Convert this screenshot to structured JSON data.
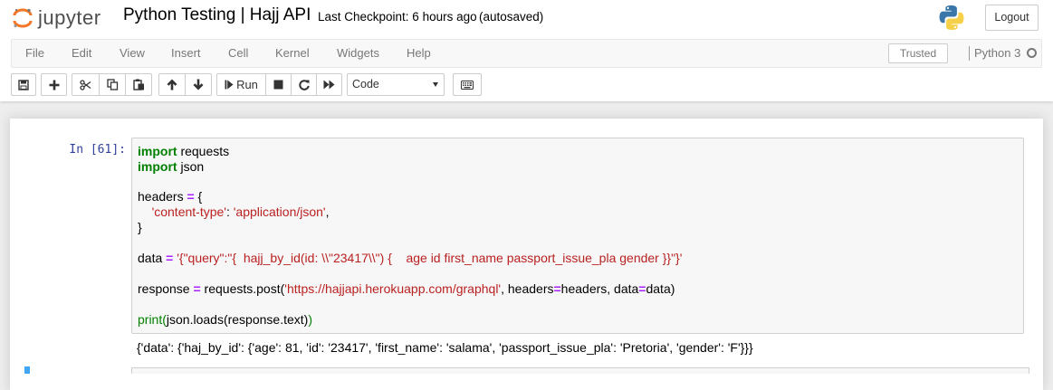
{
  "header": {
    "logo_text": "jupyter",
    "notebook_name": "Python Testing | Hajj API",
    "checkpoint": "Last Checkpoint: 6 hours ago",
    "autosave_status": "(autosaved)",
    "kernel_logo_icon": "python-logo-icon",
    "logout_label": "Logout"
  },
  "menubar": {
    "items": [
      "File",
      "Edit",
      "View",
      "Insert",
      "Cell",
      "Kernel",
      "Widgets",
      "Help"
    ],
    "trusted_label": "Trusted",
    "kernel_name": "Python 3",
    "kernel_indicator_icon": "kernel-idle-circle-icon"
  },
  "toolbar": {
    "icons": [
      "save-icon",
      "plus-icon",
      "cut-icon",
      "copy-icon",
      "paste-icon",
      "arrow-up-icon",
      "arrow-down-icon",
      "run-icon",
      "stop-icon",
      "restart-icon",
      "fast-forward-icon",
      "keyboard-icon"
    ],
    "run_label": "Run",
    "cell_type": "Code"
  },
  "cell": {
    "prompt": "In [61]:",
    "code": {
      "l1_kw": "import",
      "l1_rest": " requests",
      "l2_kw": "import",
      "l2_rest": " json",
      "l4_a": "headers ",
      "l4_op": "=",
      "l4_b": " {",
      "l5_indent": "    ",
      "l5_str1": "'content-type'",
      "l5_colon": ": ",
      "l5_str2": "'application/json'",
      "l5_end": ",",
      "l6": "}",
      "l8_a": "data ",
      "l8_op": "=",
      "l8_sp": " ",
      "l8_str": "'{\"query\":\"{  hajj_by_id(id: \\\\\"23417\\\\\") {    age id first_name passport_issue_pla gender }}\"}'",
      "l10_a": "response ",
      "l10_op": "=",
      "l10_b": " requests.post(",
      "l10_str": "'https://hajjapi.herokuapp.com/graphql'",
      "l10_c": ", headers",
      "l10_op2": "=",
      "l10_d": "headers, data",
      "l10_op3": "=",
      "l10_e": "data)",
      "l12_bi": "print",
      "l12_p": "(",
      "l12_mid": "json.loads(response.text)",
      "l12_pend": ")"
    },
    "output": "{'data': {'haj_by_id': {'age': 81, 'id': '23417', 'first_name': 'salama', 'passport_issue_pla': 'Pretoria', 'gender': 'F'}}}"
  },
  "colors": {
    "keyword": "#008000",
    "operator": "#aa22ff",
    "string": "#ba2121",
    "prompt": "#303f9f",
    "selected_cell_bar": "#42a5f5"
  }
}
